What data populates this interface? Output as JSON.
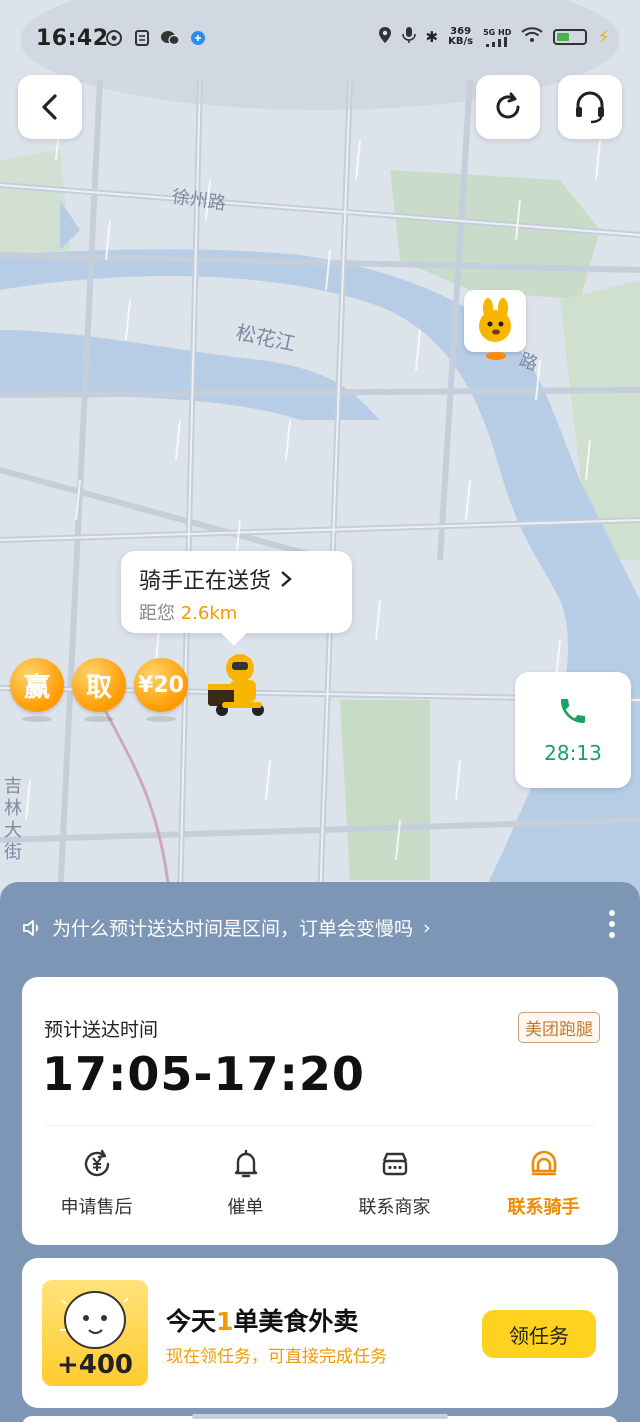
{
  "status_bar": {
    "time": "16:42",
    "net_speed_value": "369",
    "net_speed_unit": "KB/s",
    "signal_label": "5G HD"
  },
  "map": {
    "road_xuzhou": "徐州路",
    "river_songhua": "松花江",
    "road_jilin": "吉林大街",
    "road_partial": "路"
  },
  "rider_bubble": {
    "title": "骑手正在送货",
    "distance_prefix": "距您",
    "distance_value": "2.6km"
  },
  "coins": [
    {
      "label": "赢"
    },
    {
      "label": "取"
    },
    {
      "label": "¥20"
    }
  ],
  "call_card": {
    "icon": "phone-icon",
    "timer": "28:13"
  },
  "notice": {
    "text": "为什么预计送达时间是区间，订单会变慢吗",
    "arrow": "›"
  },
  "eta_card": {
    "label": "预计送达时间",
    "brand_tag": "美团跑腿",
    "time_range": "17:05-17:20",
    "actions": [
      {
        "label": "申请售后",
        "icon": "yen-refresh-icon"
      },
      {
        "label": "催单",
        "icon": "bell-icon"
      },
      {
        "label": "联系商家",
        "icon": "merchant-chat-icon"
      },
      {
        "label": "联系骑手",
        "icon": "rider-helmet-icon",
        "active": true
      }
    ]
  },
  "task_card": {
    "points": "+400",
    "title_prefix": "今天",
    "title_highlight": "1",
    "title_suffix": "单美食外卖",
    "subtitle": "现在领任务，可直接完成任务",
    "button": "领任务"
  },
  "colors": {
    "accent_orange": "#f29b00",
    "call_green": "#1aa260",
    "panel_blue": "#7d96b6",
    "button_yellow": "#ffd21f"
  }
}
